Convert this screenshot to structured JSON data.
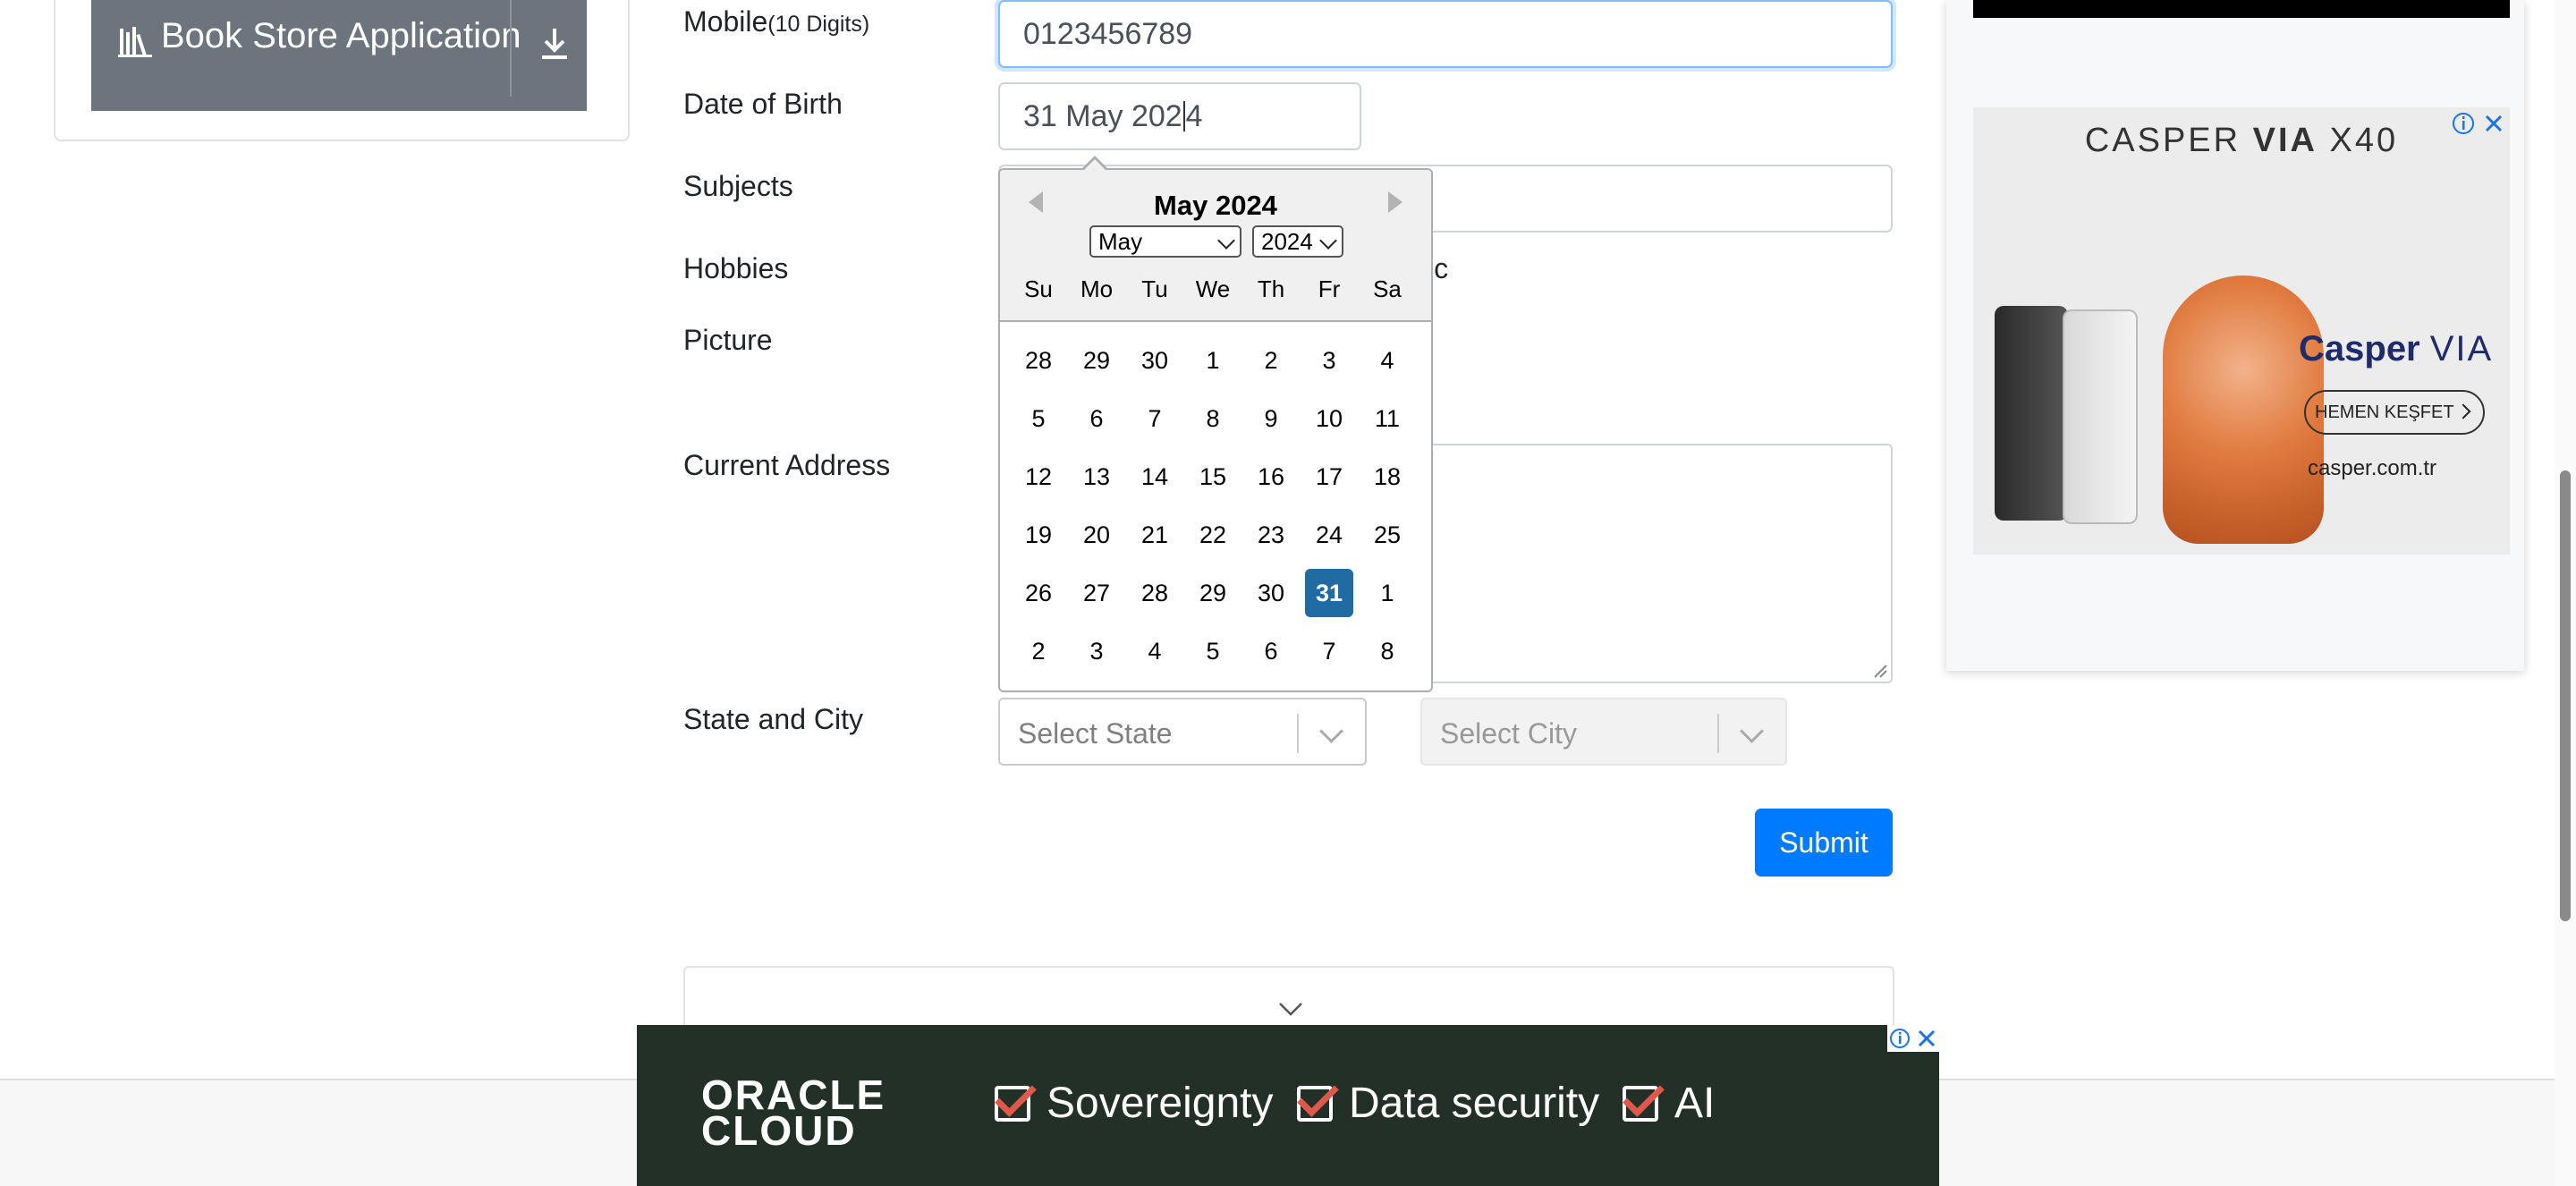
{
  "sidebar": {
    "book_store_label": "Book Store Application"
  },
  "form": {
    "mobile_label": "Mobile",
    "mobile_hint": "(10 Digits)",
    "mobile_value": "0123456789",
    "dob_label": "Date of Birth",
    "dob_value_before_caret": "31 May 202",
    "dob_value_after_caret": "4",
    "subjects_label": "Subjects",
    "hobbies_label": "Hobbies",
    "hobbies_partial_text": "ic",
    "picture_label": "Picture",
    "address_label": "Current Address",
    "state_city_label": "State and City",
    "state_placeholder": "Select State",
    "city_placeholder": "Select City",
    "submit_label": "Submit"
  },
  "datepicker": {
    "title": "May 2024",
    "month_select": "May",
    "year_select": "2024",
    "weekdays": [
      "Su",
      "Mo",
      "Tu",
      "We",
      "Th",
      "Fr",
      "Sa"
    ],
    "weeks": [
      [
        "28",
        "29",
        "30",
        "1",
        "2",
        "3",
        "4"
      ],
      [
        "5",
        "6",
        "7",
        "8",
        "9",
        "10",
        "11"
      ],
      [
        "12",
        "13",
        "14",
        "15",
        "16",
        "17",
        "18"
      ],
      [
        "19",
        "20",
        "21",
        "22",
        "23",
        "24",
        "25"
      ],
      [
        "26",
        "27",
        "28",
        "29",
        "30",
        "31",
        "1"
      ],
      [
        "2",
        "3",
        "4",
        "5",
        "6",
        "7",
        "8"
      ]
    ],
    "selected_day": "31"
  },
  "ads": {
    "casper": {
      "title_a": "CASPER ",
      "title_b": "VIA",
      "title_c": " X40",
      "brand": "Casper",
      "brand_suffix": "VIA",
      "cta": "HEMEN KEŞFET",
      "url": "casper.com.tr"
    },
    "oracle": {
      "logo_line1": "ORACLE",
      "logo_line2": "CLOUD",
      "items": [
        "Sovereignty",
        "Data security",
        "AI"
      ]
    }
  },
  "colors": {
    "primary": "#007bff",
    "selected_day": "#216ba5",
    "oracle_bg": "#223027",
    "check_red": "#e0584a"
  }
}
